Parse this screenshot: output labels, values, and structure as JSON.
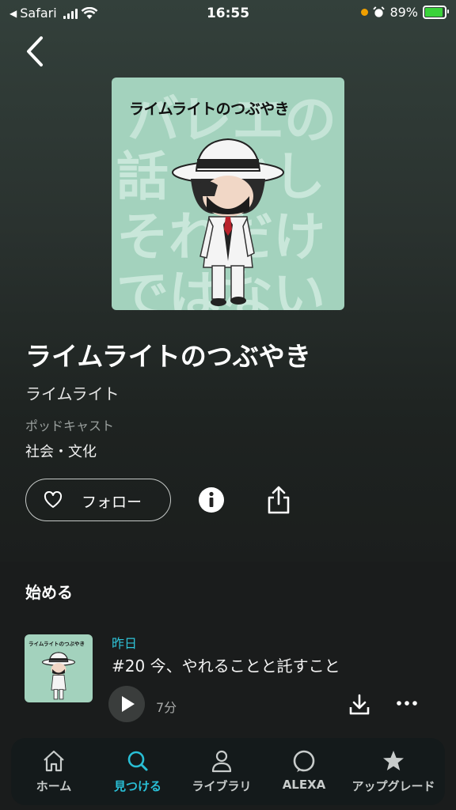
{
  "status_bar": {
    "back_app": "Safari",
    "time": "16:55",
    "battery": "89%"
  },
  "artwork": {
    "header_text": "ライムライトのつぶやき",
    "bg_lines": [
      "バレエの",
      "話　かし",
      "それだけ",
      "ではない"
    ]
  },
  "podcast": {
    "title": "ライムライトのつぶやき",
    "author": "ライムライト",
    "type": "ポッドキャスト",
    "genre": "社会・文化"
  },
  "actions": {
    "follow_label": "フォロー"
  },
  "section": {
    "title": "始める"
  },
  "episode": {
    "date": "昨日",
    "title": "#20 今、やれることと託すこと",
    "duration": "7分",
    "thumb_text": "ライムライトのつぶやき"
  },
  "nav": {
    "items": [
      {
        "label": "ホーム",
        "icon": "home-icon"
      },
      {
        "label": "見つける",
        "icon": "search-icon"
      },
      {
        "label": "ライブラリ",
        "icon": "person-icon"
      },
      {
        "label": "ALEXA",
        "icon": "alexa-icon"
      },
      {
        "label": "アップグレード",
        "icon": "star-icon"
      }
    ],
    "active_index": 1
  },
  "colors": {
    "accent": "#29bfd6",
    "art_bg": "#a3d2bd"
  }
}
